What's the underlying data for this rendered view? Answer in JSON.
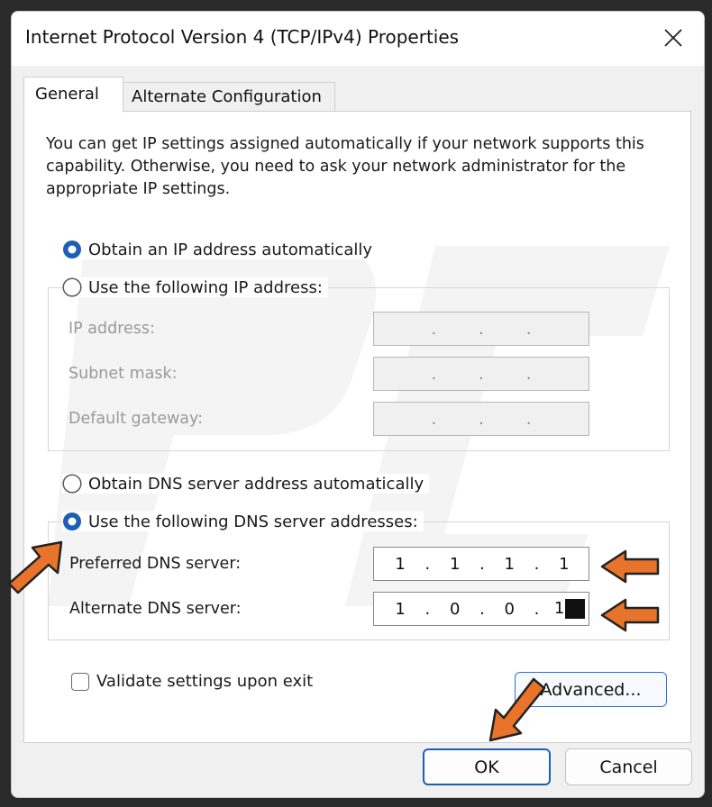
{
  "window": {
    "title": "Internet Protocol Version 4 (TCP/IPv4) Properties"
  },
  "tabs": [
    {
      "label": "General",
      "selected": true
    },
    {
      "label": "Alternate Configuration",
      "selected": false
    }
  ],
  "description": "You can get IP settings assigned automatically if your network supports this capability. Otherwise, you need to ask your network administrator for the appropriate IP settings.",
  "ip_section": {
    "auto_label": "Obtain an IP address automatically",
    "auto_selected": true,
    "manual_label": "Use the following IP address:",
    "manual_selected": false,
    "fields": [
      {
        "label": "IP address:",
        "octets": [
          "",
          "",
          "",
          ""
        ]
      },
      {
        "label": "Subnet mask:",
        "octets": [
          "",
          "",
          "",
          ""
        ]
      },
      {
        "label": "Default gateway:",
        "octets": [
          "",
          "",
          "",
          ""
        ]
      }
    ]
  },
  "dns_section": {
    "auto_label": "Obtain DNS server address automatically",
    "auto_selected": false,
    "manual_label": "Use the following DNS server addresses:",
    "manual_selected": true,
    "preferred": {
      "label": "Preferred DNS server:",
      "octets": [
        "1",
        "1",
        "1",
        "1"
      ]
    },
    "alternate": {
      "label": "Alternate DNS server:",
      "octets": [
        "1",
        "0",
        "0",
        "1"
      ]
    }
  },
  "validate": {
    "label": "Validate settings upon exit",
    "checked": false
  },
  "buttons": {
    "advanced": "Advanced...",
    "ok": "OK",
    "cancel": "Cancel"
  },
  "colors": {
    "accent": "#1d5fb5",
    "annotation_arrow": "#e8732a"
  },
  "icons": {
    "close": "close-icon",
    "arrow": "annotation-arrow-icon"
  }
}
